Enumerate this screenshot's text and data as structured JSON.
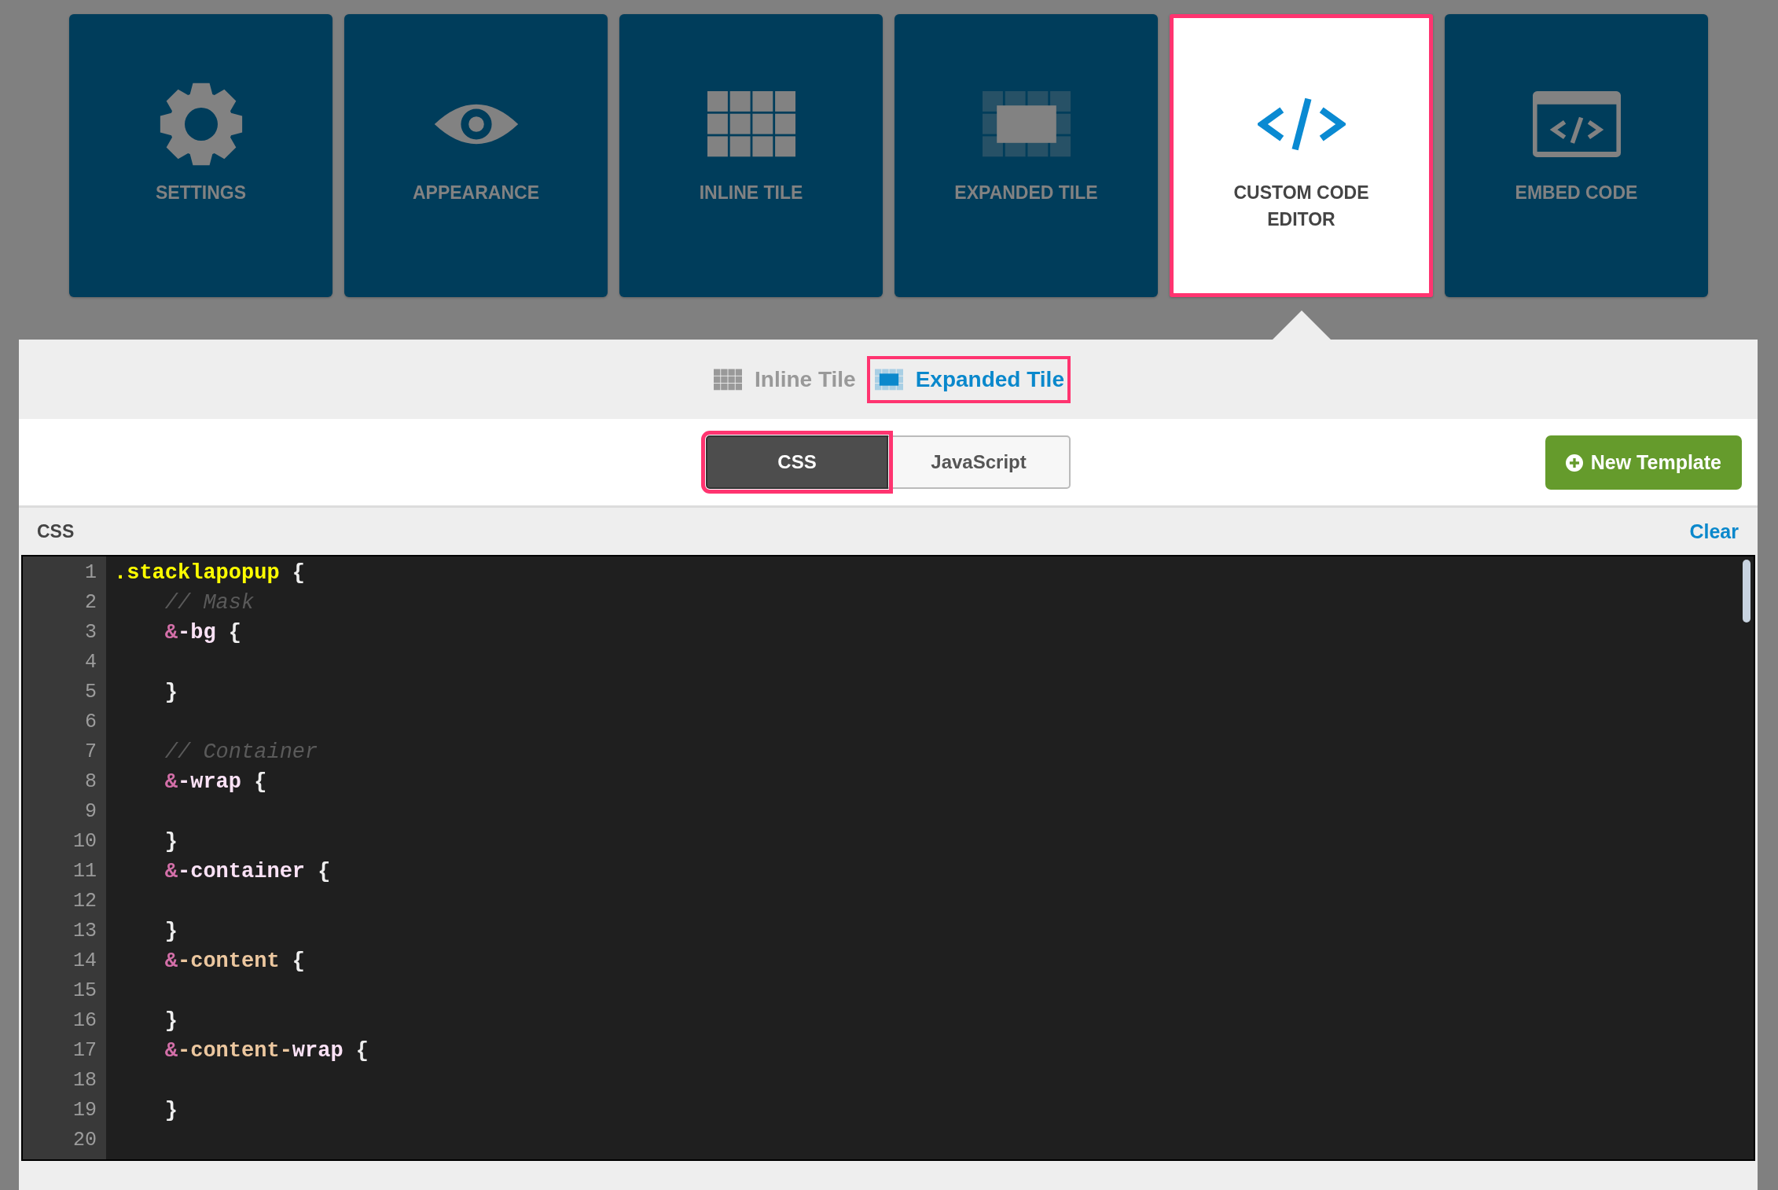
{
  "tiles": [
    {
      "label": "SETTINGS",
      "kind": "gear",
      "selected": false
    },
    {
      "label": "APPEARANCE",
      "kind": "eye",
      "selected": false
    },
    {
      "label": "INLINE TILE",
      "kind": "grid",
      "selected": false
    },
    {
      "label": "EXPANDED TILE",
      "kind": "expanded",
      "selected": false
    },
    {
      "label": "CUSTOM CODE EDITOR",
      "kind": "code",
      "selected": true
    },
    {
      "label": "EMBED CODE",
      "kind": "embed",
      "selected": false
    }
  ],
  "template_tabs": [
    {
      "label": "Inline Tile",
      "kind": "grid",
      "selected": false
    },
    {
      "label": "Expanded Tile",
      "kind": "expanded",
      "selected": true
    }
  ],
  "language_tabs": [
    {
      "label": "CSS",
      "selected": true
    },
    {
      "label": "JavaScript",
      "selected": false
    }
  ],
  "new_template_button": {
    "label": "New Template"
  },
  "editor_header": {
    "title": "CSS",
    "clear_link": "Clear"
  },
  "editor": {
    "lines": [
      {
        "number": "1",
        "tokens": [
          {
            "kind": "selector",
            "text": ".stacklapopup"
          },
          {
            "kind": "brace",
            "text": " {"
          }
        ]
      },
      {
        "number": "2",
        "tokens": [
          {
            "kind": "comment",
            "text": "    // Mask"
          }
        ]
      },
      {
        "number": "3",
        "tokens": [
          {
            "kind": "amp",
            "text": "    &"
          },
          {
            "kind": "name",
            "text": "-bg"
          },
          {
            "kind": "brace",
            "text": " {"
          }
        ]
      },
      {
        "number": "4"
      },
      {
        "number": "5",
        "tokens": [
          {
            "kind": "brace",
            "text": "    }"
          }
        ]
      },
      {
        "number": "6"
      },
      {
        "number": "7",
        "tokens": [
          {
            "kind": "comment",
            "text": "    // Container"
          }
        ]
      },
      {
        "number": "8",
        "tokens": [
          {
            "kind": "amp",
            "text": "    &"
          },
          {
            "kind": "name",
            "text": "-wrap"
          },
          {
            "kind": "brace",
            "text": " {"
          }
        ]
      },
      {
        "number": "9"
      },
      {
        "number": "10",
        "tokens": [
          {
            "kind": "brace",
            "text": "    }"
          }
        ]
      },
      {
        "number": "11",
        "tokens": [
          {
            "kind": "amp",
            "text": "    &"
          },
          {
            "kind": "name",
            "text": "-container"
          },
          {
            "kind": "brace",
            "text": " {"
          }
        ]
      },
      {
        "number": "12"
      },
      {
        "number": "13",
        "tokens": [
          {
            "kind": "brace",
            "text": "    }"
          }
        ]
      },
      {
        "number": "14",
        "tokens": [
          {
            "kind": "amp",
            "text": "    &"
          },
          {
            "kind": "attr",
            "text": "-content"
          },
          {
            "kind": "brace",
            "text": " {"
          }
        ]
      },
      {
        "number": "15"
      },
      {
        "number": "16",
        "tokens": [
          {
            "kind": "brace",
            "text": "    }"
          }
        ]
      },
      {
        "number": "17",
        "tokens": [
          {
            "kind": "amp",
            "text": "    &"
          },
          {
            "kind": "attr",
            "text": "-content-"
          },
          {
            "kind": "name",
            "text": "wrap"
          },
          {
            "kind": "brace",
            "text": " {"
          }
        ]
      },
      {
        "number": "18"
      },
      {
        "number": "19",
        "tokens": [
          {
            "kind": "brace",
            "text": "    }"
          }
        ]
      },
      {
        "number": "20"
      }
    ]
  }
}
